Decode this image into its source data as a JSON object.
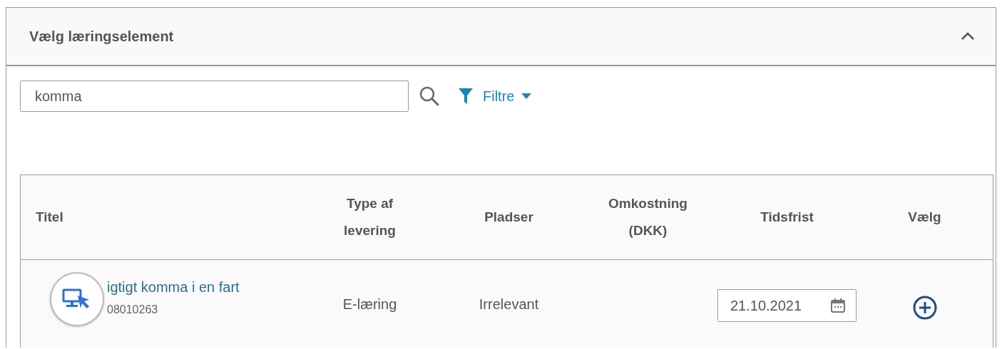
{
  "panel": {
    "title": "Vælg læringselement",
    "expanded": true
  },
  "search": {
    "value": "komma"
  },
  "filter": {
    "label": "Filtre"
  },
  "table": {
    "columns": [
      "Titel",
      "Type af levering",
      "Pladser",
      "Omkostning (DKK)",
      "Tidsfrist",
      "Vælg"
    ],
    "rows": [
      {
        "title": "igtigt komma i en fart",
        "code": "08010263",
        "delivery": "E-læring",
        "seats": "Irrelevant",
        "cost": "",
        "deadline": "21.10.2021"
      }
    ]
  }
}
